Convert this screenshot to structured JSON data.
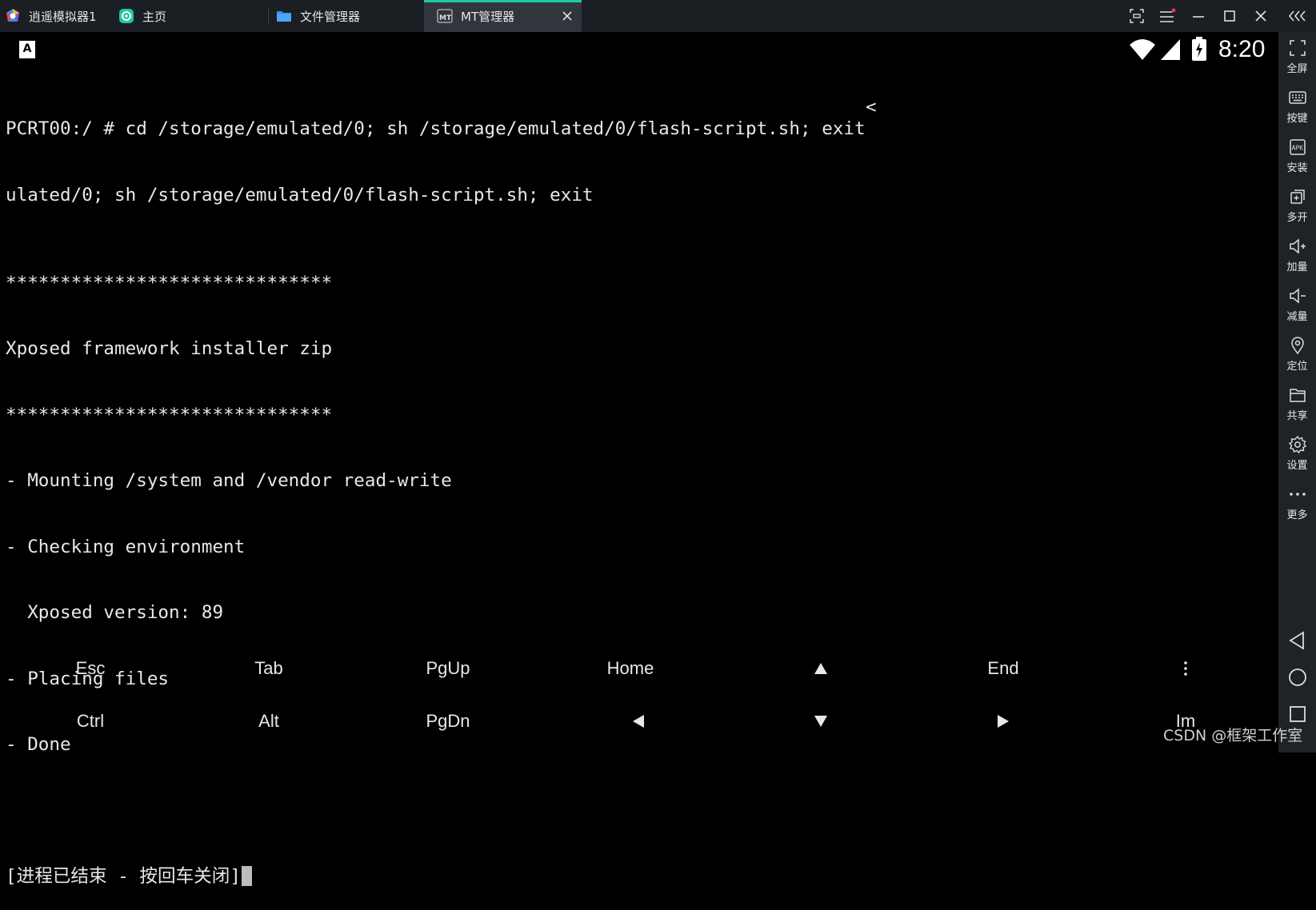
{
  "titlebar": {
    "app_name": "逍遥模拟器1",
    "tabs": [
      {
        "label": "主页",
        "icon": "home-app-icon"
      },
      {
        "label": "文件管理器",
        "icon": "folder-icon"
      },
      {
        "label": "MT管理器",
        "icon": "mt-manager-icon",
        "active": true
      }
    ],
    "accent_color": "#1ec8a5"
  },
  "statusbar": {
    "clock": "8:20",
    "keyboard_indicator": "A"
  },
  "terminal": {
    "lines": [
      "PCRT00:/ # cd /storage/emulated/0; sh /storage/emulated/0/flash-script.sh; exit",
      "ulated/0; sh /storage/emulated/0/flash-script.sh; exit",
      "******************************",
      "Xposed framework installer zip",
      "******************************",
      "- Mounting /system and /vendor read-write",
      "- Checking environment",
      "  Xposed version: 89",
      "- Placing files",
      "- Done",
      "",
      "[进程已结束 - 按回车关闭]"
    ],
    "wrap_marker": "<"
  },
  "extra_keys": {
    "row1": [
      "Esc",
      "Tab",
      "PgUp",
      "Home",
      "up-arrow-icon",
      "End",
      "more-vertical-icon"
    ],
    "row2": [
      "Ctrl",
      "Alt",
      "PgDn",
      "left-arrow-icon",
      "down-arrow-icon",
      "right-arrow-icon",
      "Im"
    ]
  },
  "sidebar": {
    "items": [
      {
        "label": "全屏",
        "icon": "fullscreen-icon"
      },
      {
        "label": "按键",
        "icon": "keyboard-icon"
      },
      {
        "label": "安装",
        "icon": "apk-icon"
      },
      {
        "label": "多开",
        "icon": "multi-instance-icon"
      },
      {
        "label": "加量",
        "icon": "volume-up-icon"
      },
      {
        "label": "减量",
        "icon": "volume-down-icon"
      },
      {
        "label": "定位",
        "icon": "location-icon"
      },
      {
        "label": "共享",
        "icon": "folder-share-icon"
      },
      {
        "label": "设置",
        "icon": "gear-icon"
      },
      {
        "label": "更多",
        "icon": "more-horizontal-icon"
      }
    ]
  },
  "watermark": "CSDN @框架工作室"
}
